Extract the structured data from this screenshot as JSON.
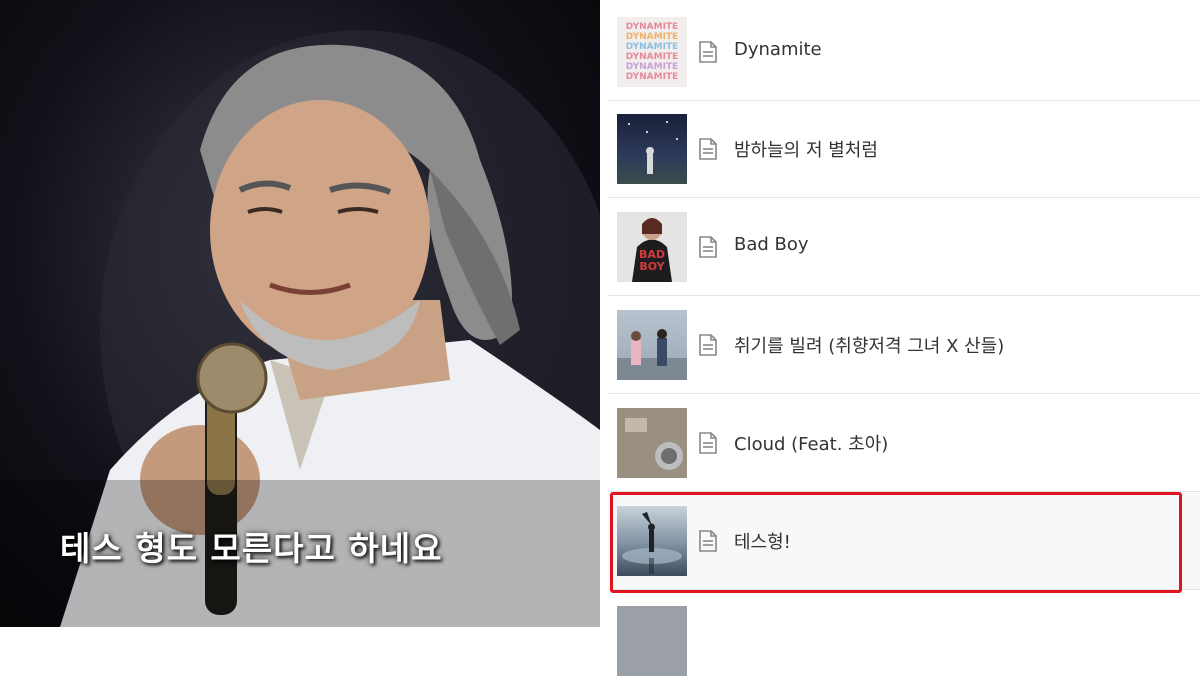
{
  "video": {
    "subtitle": "테스 형도 모른다고 하네요"
  },
  "playlist": {
    "items": [
      {
        "title": "Dynamite",
        "thumb_text": "DYNAMITE"
      },
      {
        "title": "밤하늘의 저 별처럼"
      },
      {
        "title": "Bad Boy",
        "thumb_text": "BAD BOY"
      },
      {
        "title": "취기를 빌려 (취향저격 그녀 X 산들)"
      },
      {
        "title": "Cloud (Feat. 초아)"
      },
      {
        "title": "테스형!",
        "selected": true
      }
    ]
  },
  "colors": {
    "highlight": "#e0141e",
    "row_divider": "#e6e6e6",
    "title_text": "#333333"
  }
}
